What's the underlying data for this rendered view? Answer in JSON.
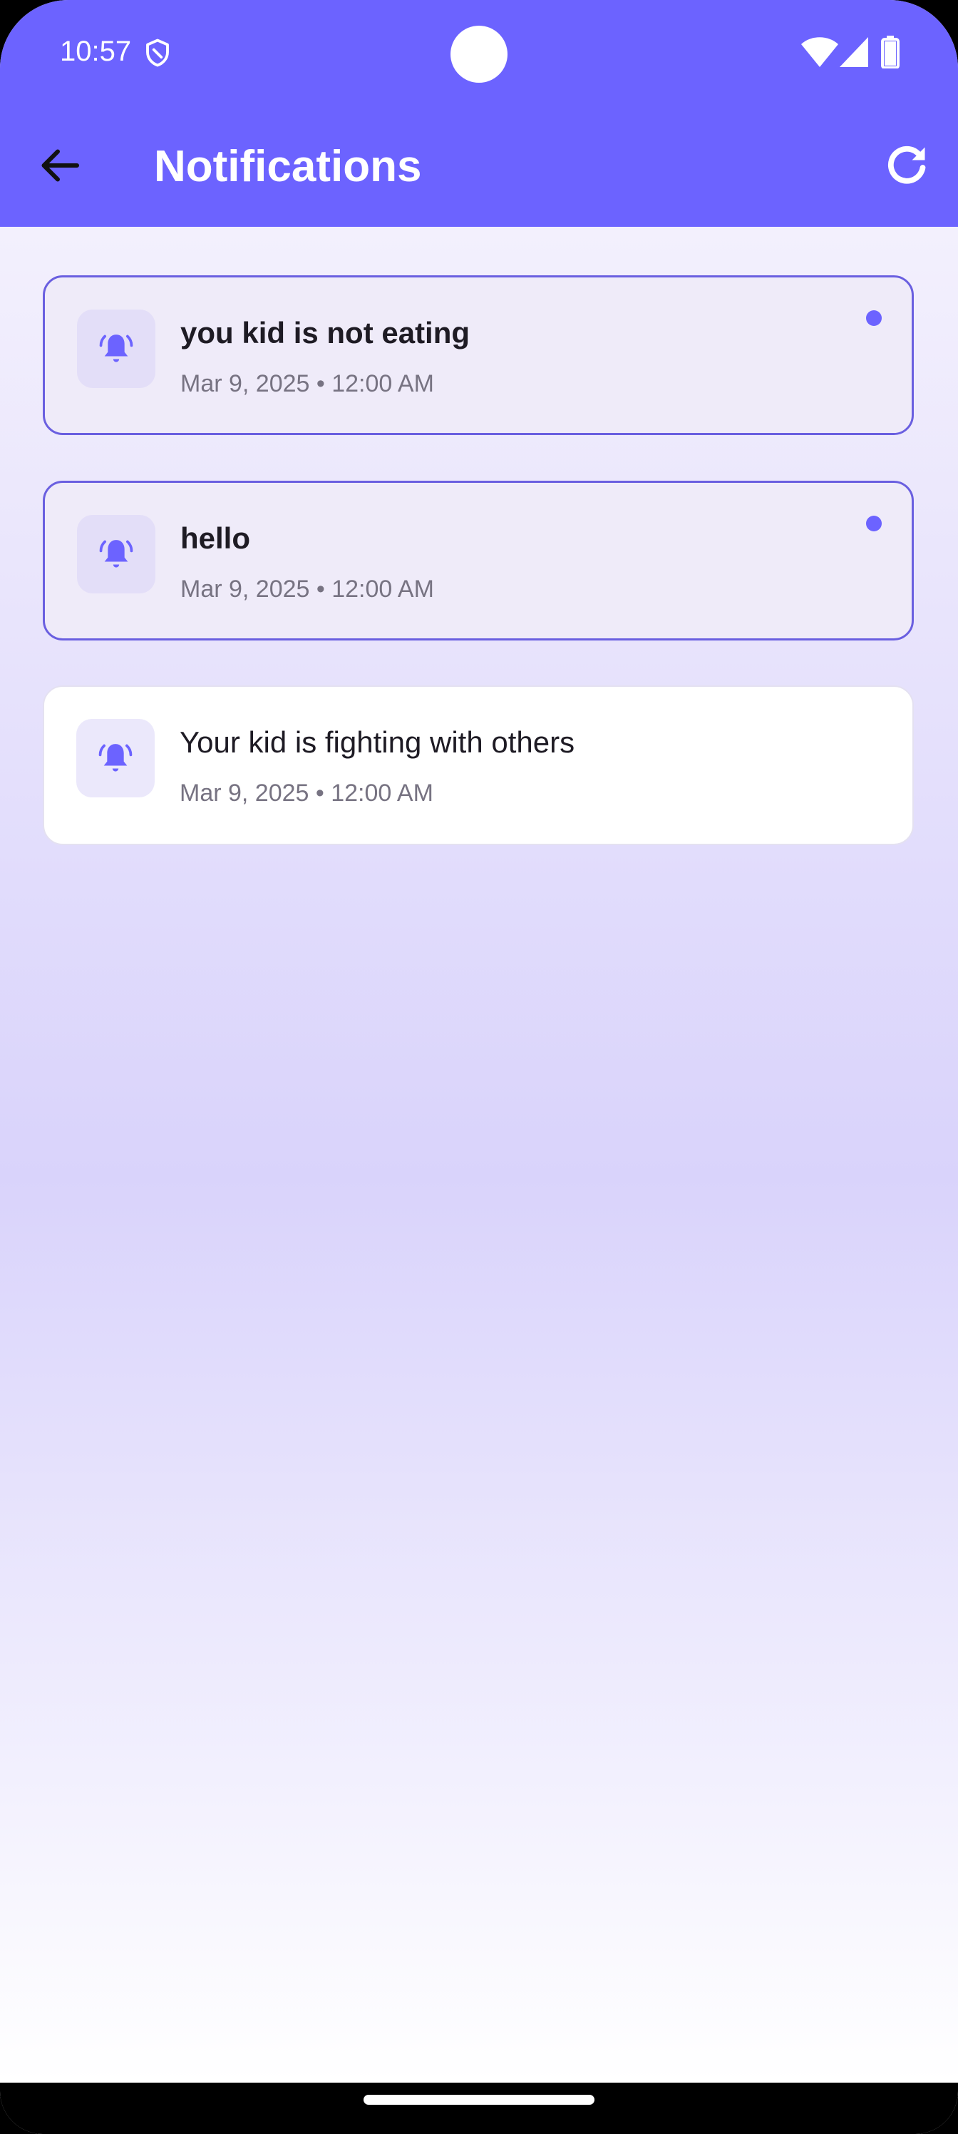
{
  "status_bar": {
    "time": "10:57"
  },
  "app_bar": {
    "title": "Notifications"
  },
  "notifications": [
    {
      "title": "you kid is not eating",
      "time": "Mar 9, 2025 • 12:00 AM",
      "unread": true
    },
    {
      "title": "hello",
      "time": "Mar 9, 2025 • 12:00 AM",
      "unread": true
    },
    {
      "title": "Your kid is fighting with others",
      "time": "Mar 9, 2025 • 12:00 AM",
      "unread": false
    }
  ],
  "colors": {
    "primary": "#6c63ff",
    "unread_border": "#6a5fe0",
    "unread_background": "#efebf9",
    "read_background": "#ffffff"
  },
  "icons": {
    "back": "arrow-back-icon",
    "refresh": "refresh-icon",
    "notification": "bell-ringing-icon"
  }
}
